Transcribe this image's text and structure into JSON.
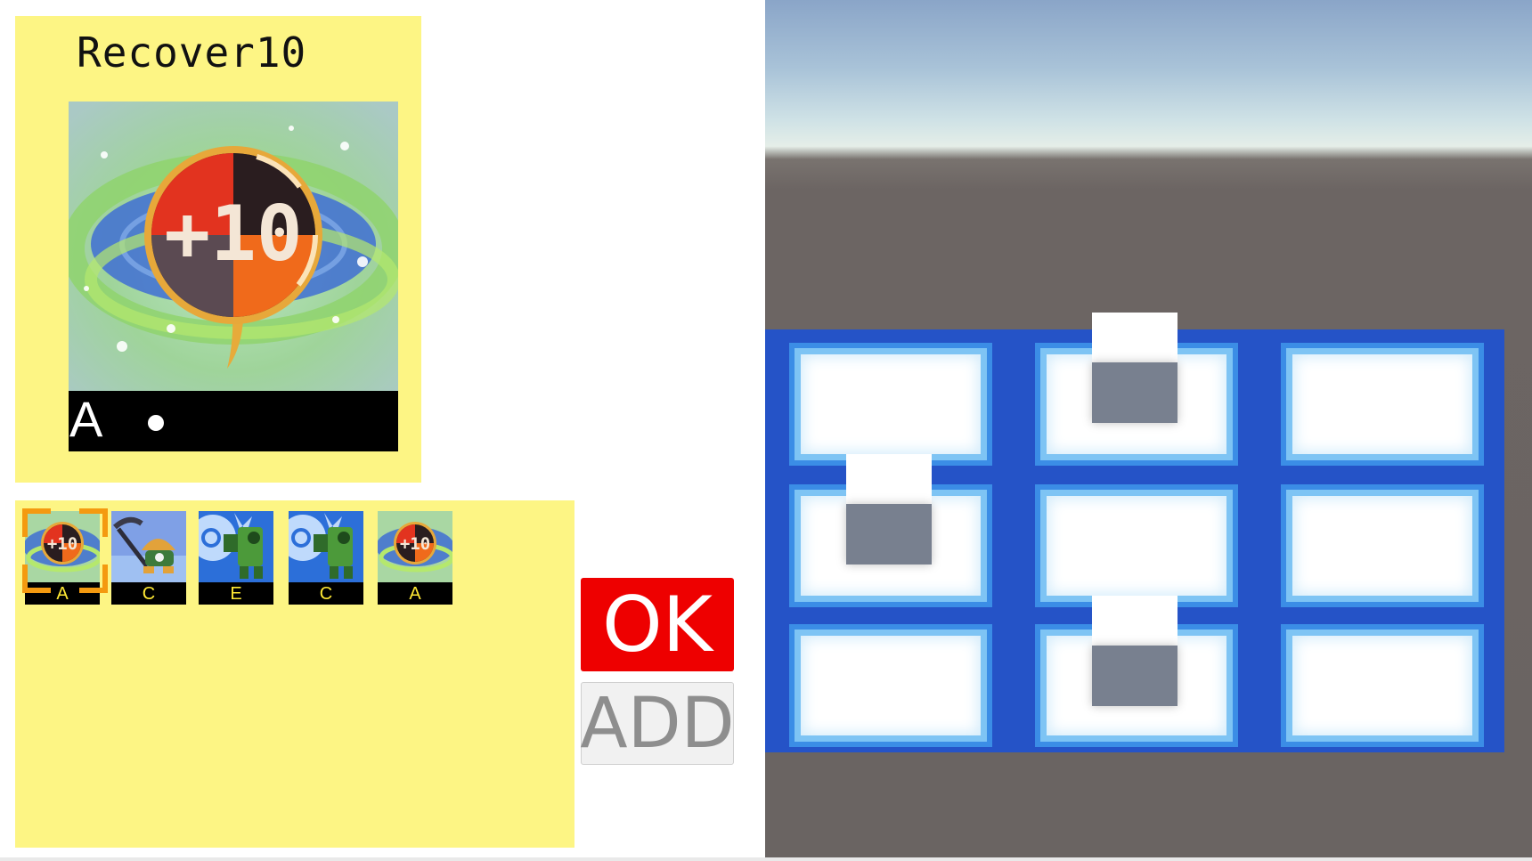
{
  "selected_chip": {
    "name": "Recover10",
    "code": "A",
    "art_text": "+10"
  },
  "folder": {
    "chips": [
      {
        "code": "A",
        "icon": "recover10-icon",
        "selected": true
      },
      {
        "code": "C",
        "icon": "mettaur-icon",
        "selected": false
      },
      {
        "code": "E",
        "icon": "cannon-icon",
        "selected": false
      },
      {
        "code": "C",
        "icon": "cannon-icon",
        "selected": false
      },
      {
        "code": "A",
        "icon": "recover10-icon",
        "selected": false
      }
    ]
  },
  "buttons": {
    "ok_label": "OK",
    "add_label": "ADD"
  },
  "colors": {
    "panel": "#fdf584",
    "ok_bg": "#ee0000",
    "add_bg": "#f1f1f1",
    "field_blue": "#2553c7",
    "selection_frame": "#f49a10"
  },
  "battlefield": {
    "rows": 3,
    "cols": 3,
    "occupied_panels": [
      [
        0,
        1
      ],
      [
        1,
        0
      ],
      [
        2,
        1
      ]
    ]
  }
}
